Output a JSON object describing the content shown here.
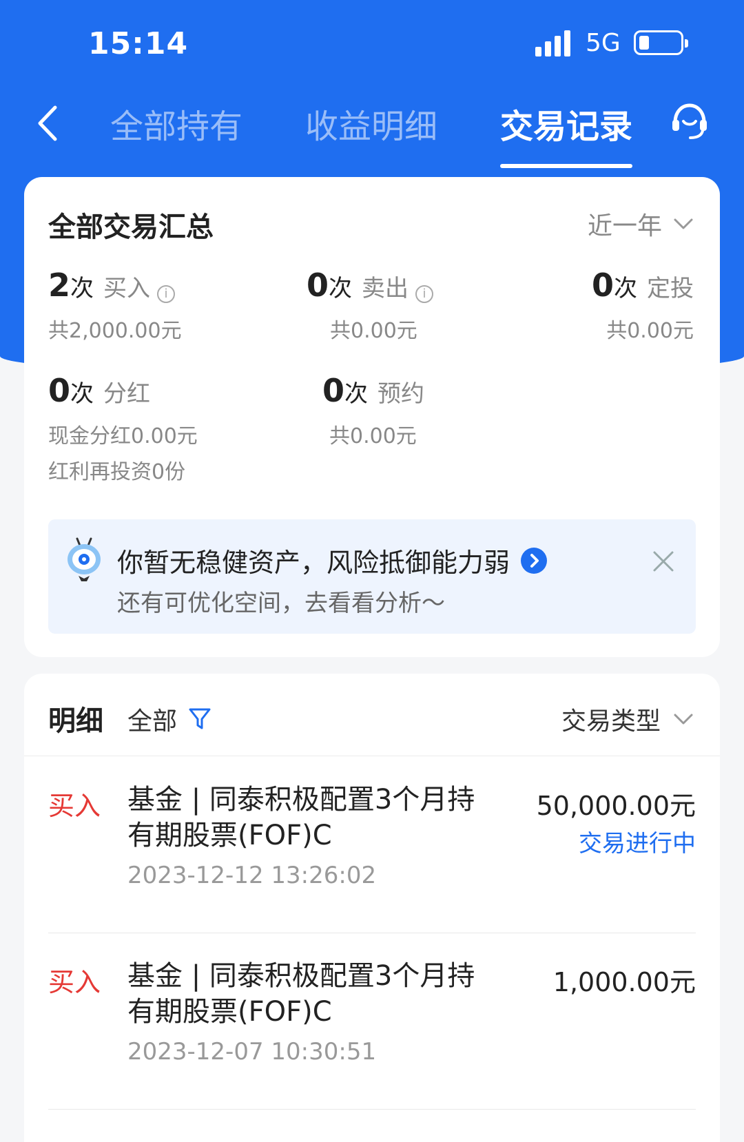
{
  "status_bar": {
    "time": "15:14",
    "network": "5G"
  },
  "nav": {
    "tabs": [
      {
        "label": "全部持有"
      },
      {
        "label": "收益明细"
      },
      {
        "label": "交易记录"
      }
    ],
    "active_tab": 2
  },
  "summary": {
    "title": "全部交易汇总",
    "period": "近一年",
    "unit": "次",
    "buy": {
      "count": "2",
      "label": "买入",
      "total": "共2,000.00元"
    },
    "sell": {
      "count": "0",
      "label": "卖出",
      "total": "共0.00元"
    },
    "sip": {
      "count": "0",
      "label": "定投",
      "total": "共0.00元"
    },
    "dividend": {
      "count": "0",
      "label": "分红",
      "cash": "现金分红0.00元",
      "reinvest": "红利再投资0份"
    },
    "reserve": {
      "count": "0",
      "label": "预约",
      "total": "共0.00元"
    }
  },
  "tip": {
    "main": "你暂无稳健资产，风险抵御能力弱",
    "sub": "还有可优化空间，去看看分析～"
  },
  "detail": {
    "title": "明细",
    "filter": "全部",
    "type_select": "交易类型",
    "rows": [
      {
        "type": "买入",
        "name": "基金 | 同泰积极配置3个月持有期股票(FOF)C",
        "date": "2023-12-12 13:26:02",
        "amount": "50,000.00元",
        "status": "交易进行中"
      },
      {
        "type": "买入",
        "name": "基金 | 同泰积极配置3个月持有期股票(FOF)C",
        "date": "2023-12-07 10:30:51",
        "amount": "1,000.00元",
        "status": ""
      }
    ]
  },
  "colors": {
    "brand": "#1f6ef0",
    "buy": "#e53935",
    "status_pending": "#1f6ef0"
  }
}
